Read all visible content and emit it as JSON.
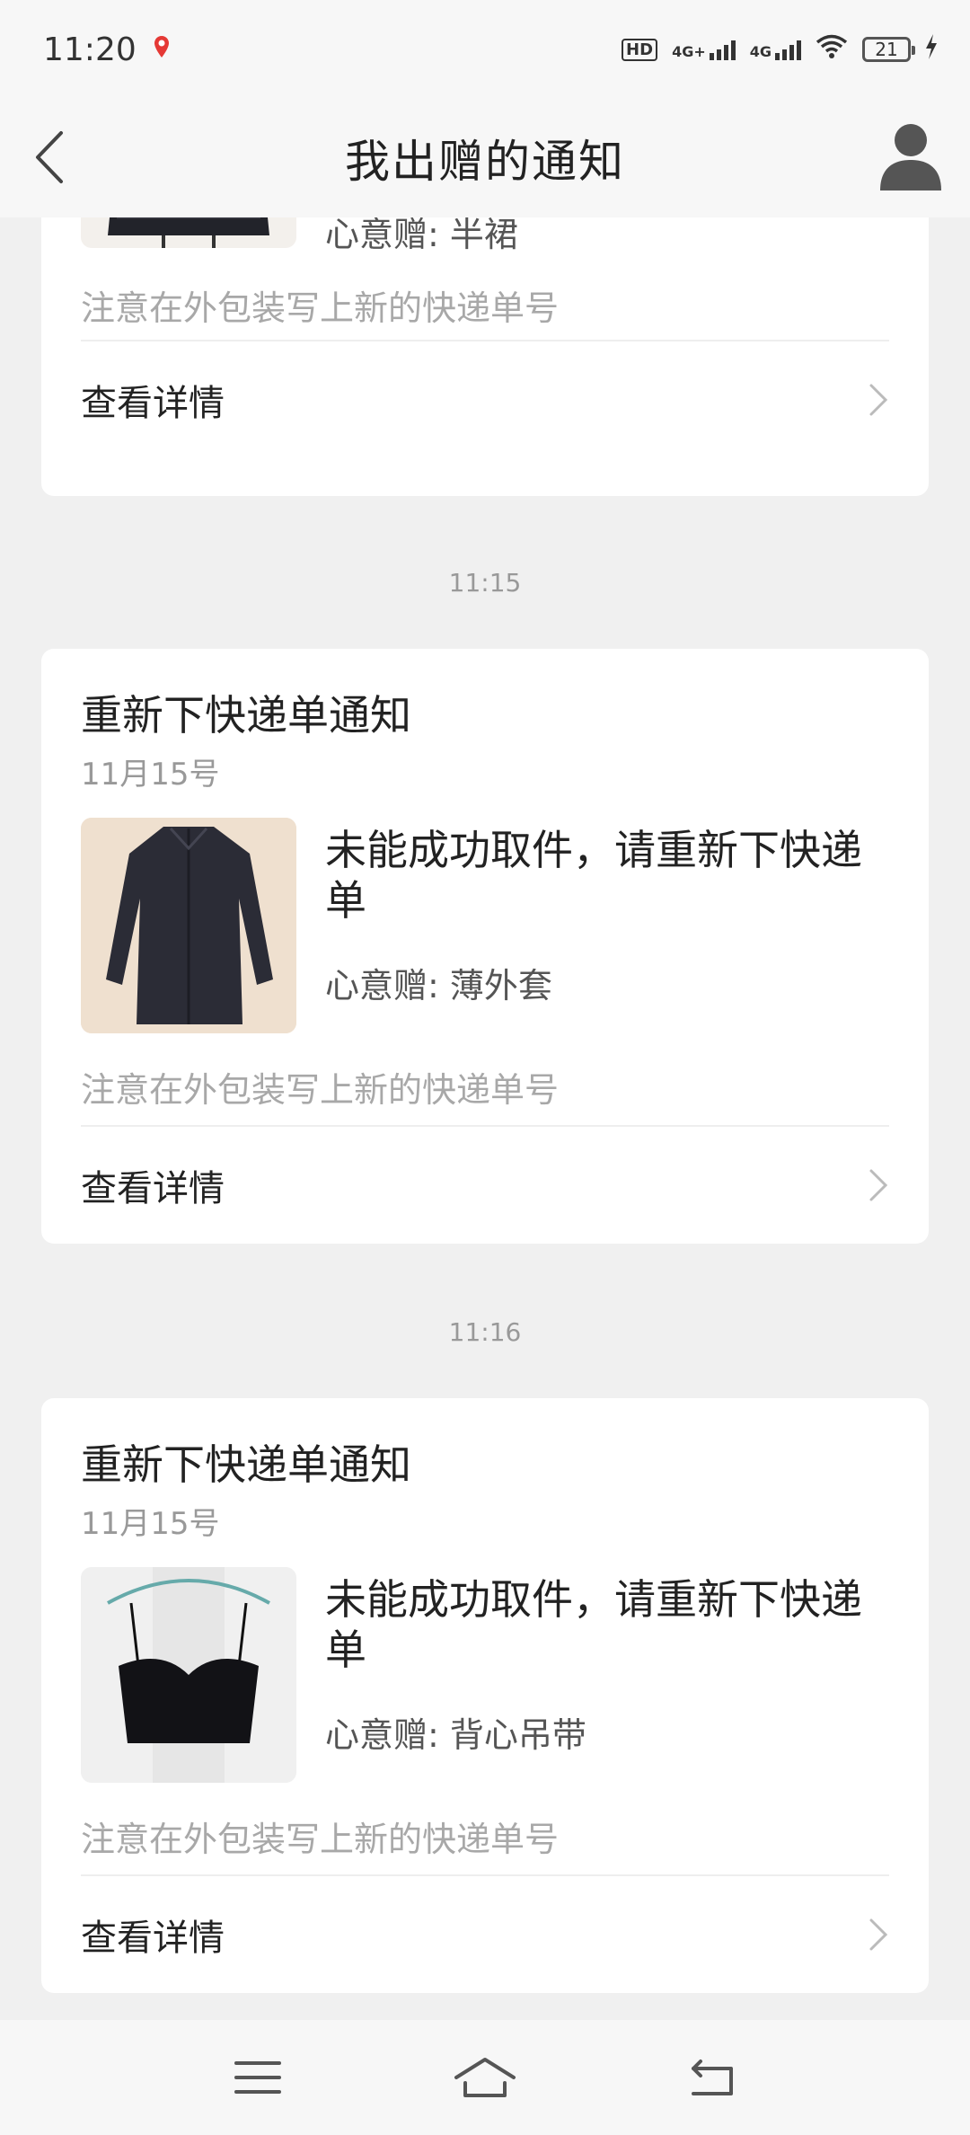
{
  "status_bar": {
    "time": "11:20",
    "hd_label": "HD",
    "net1": "4G+",
    "net2": "4G",
    "battery": "21"
  },
  "header": {
    "title": "我出赠的通知"
  },
  "cards": [
    {
      "gift": "心意赠: 半裙",
      "note": "注意在外包装写上新的快递单号",
      "detail_label": "查看详情"
    },
    {
      "time": "11:15",
      "title": "重新下快递单通知",
      "date": "11月15号",
      "message": "未能成功取件，请重新下快递单",
      "gift": "心意赠: 薄外套",
      "note": "注意在外包装写上新的快递单号",
      "detail_label": "查看详情"
    },
    {
      "time": "11:16",
      "title": "重新下快递单通知",
      "date": "11月15号",
      "message": "未能成功取件，请重新下快递单",
      "gift": "心意赠: 背心吊带",
      "note": "注意在外包装写上新的快递单号",
      "detail_label": "查看详情"
    }
  ],
  "icons": {
    "back": "chevron-left-icon",
    "avatar": "user-avatar-icon",
    "detail_arrow": "chevron-right-icon",
    "nav_menu": "menu-icon",
    "nav_home": "home-icon",
    "nav_back": "back-icon"
  },
  "colors": {
    "background": "#f0f0f0",
    "card": "#ffffff",
    "muted_text": "#999999"
  }
}
